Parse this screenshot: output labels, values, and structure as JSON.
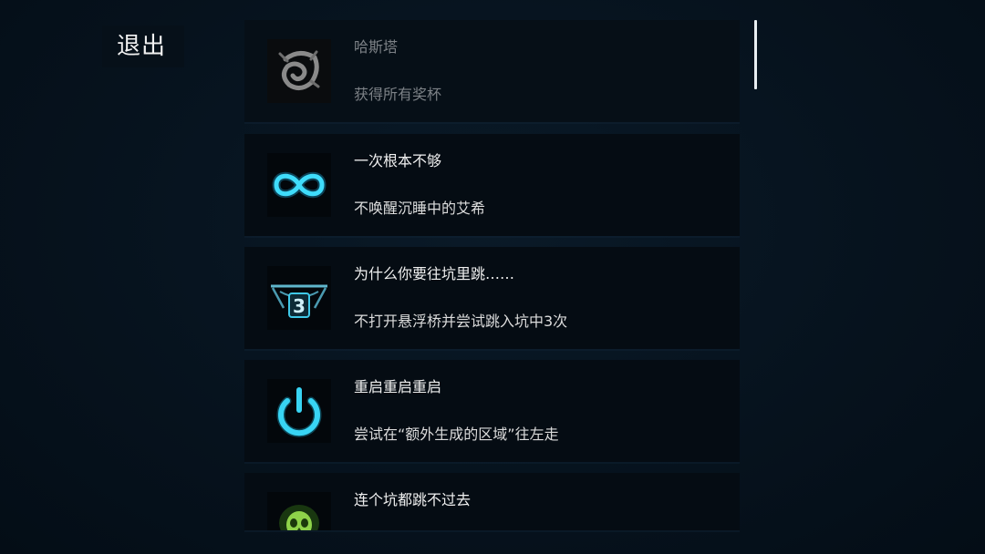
{
  "exit_label": "退出",
  "achievements": [
    {
      "title": "哈斯塔",
      "description": "获得所有奖杯",
      "icon": "hastur-sigil-icon",
      "state": "locked"
    },
    {
      "title": "一次根本不够",
      "description": "不唤醒沉睡中的艾希",
      "icon": "infinity-icon",
      "state": "unlocked"
    },
    {
      "title": "为什么你要往坑里跳……",
      "description": "不打开悬浮桥并尝试跳入坑中3次",
      "icon": "bridge-three-icon",
      "state": "unlocked",
      "icon_text": "3"
    },
    {
      "title": "重启重启重启",
      "description": "尝试在“额外生成的区域”往左走",
      "icon": "power-icon",
      "state": "unlocked"
    },
    {
      "title": "连个坑都跳不过去",
      "description": "",
      "icon": "green-skull-icon",
      "state": "unlocked"
    }
  ],
  "colors": {
    "accent": "#2fd0f0",
    "skull": "#7ccf3a",
    "locked_text": "#7c8186",
    "background": "#06121d"
  }
}
